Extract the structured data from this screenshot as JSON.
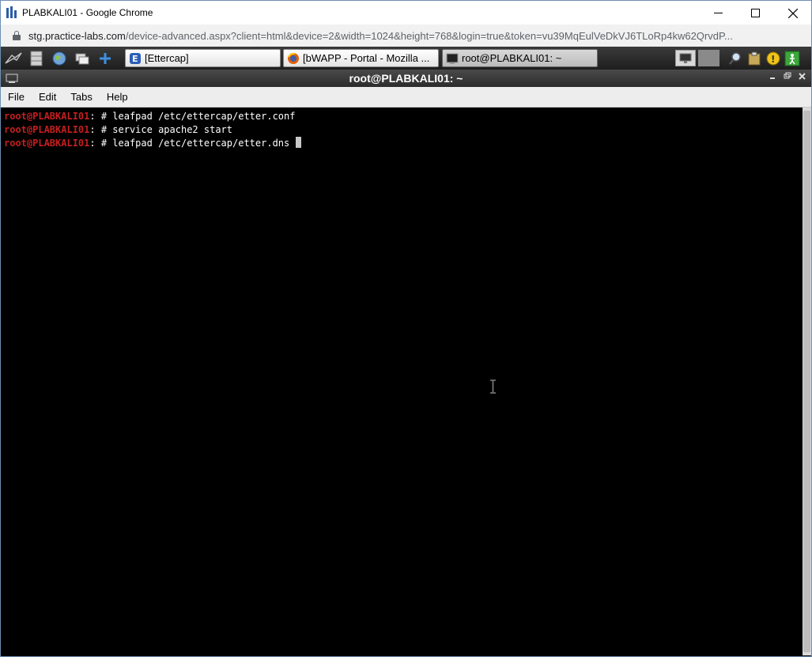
{
  "chrome": {
    "window_title": "PLABKALI01 - Google Chrome",
    "url_host": "stg.practice-labs.com",
    "url_path": "/device-advanced.aspx?client=html&device=2&width=1024&height=768&login=true&token=vu39MqEulVeDkVJ6TLoRp4kw62QrvdP...",
    "buttons": {
      "minimize": "─",
      "maximize": "☐",
      "close": "✕"
    }
  },
  "taskbar": {
    "tasks": [
      {
        "label": "[Ettercap]",
        "icon": "ettercap-icon"
      },
      {
        "label": "[bWAPP - Portal - Mozilla ...",
        "icon": "firefox-icon"
      },
      {
        "label": "root@PLABKALI01: ~",
        "icon": "terminal-icon"
      }
    ]
  },
  "terminal": {
    "title": "root@PLABKALI01: ~",
    "menu": [
      "File",
      "Edit",
      "Tabs",
      "Help"
    ],
    "lines": [
      {
        "prompt": "root@PLABKALI01",
        "rest": ": # leafpad /etc/ettercap/etter.conf"
      },
      {
        "prompt": "root@PLABKALI01",
        "rest": ": # service apache2 start"
      },
      {
        "prompt": "root@PLABKALI01",
        "rest": ": # leafpad /etc/ettercap/etter.dns "
      }
    ]
  },
  "colors": {
    "prompt": "#c51f1f",
    "terminal_bg": "#000000",
    "terminal_fg": "#ffffff",
    "window_border": "#6e8fb3"
  }
}
